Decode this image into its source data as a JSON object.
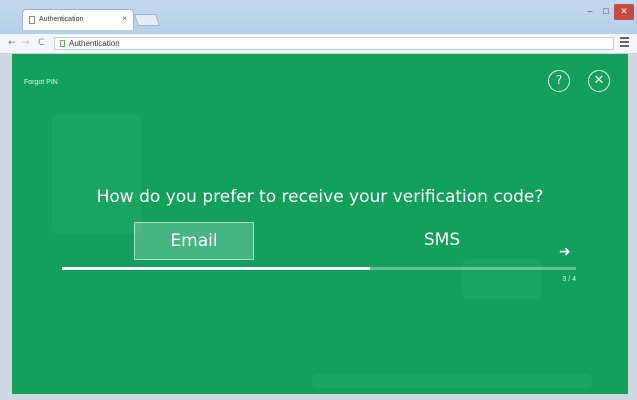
{
  "browser": {
    "tab_title": "Authentication",
    "tab_close": "×",
    "url": "Authentication",
    "window_controls": {
      "minimize": "–",
      "maximize": "□",
      "close": "✕"
    },
    "nav": {
      "back": "←",
      "forward": "→",
      "reload": "C"
    }
  },
  "page": {
    "forgot_pin": "Forgot PIN",
    "help_icon": "?",
    "close_icon": "✕",
    "question": "How do you prefer to receive your verification code?",
    "options": [
      {
        "label": "Email",
        "selected": true
      },
      {
        "label": "SMS",
        "selected": false
      }
    ],
    "next_arrow": "➜",
    "step": "3 / 4",
    "progress": 0.6
  },
  "colors": {
    "background": "#12a05c",
    "accent": "#ffffff",
    "window_close": "#c94a3c"
  },
  "icons": [
    "document-icon",
    "help-icon",
    "close-icon",
    "arrow-right-icon",
    "hamburger-menu-icon"
  ]
}
